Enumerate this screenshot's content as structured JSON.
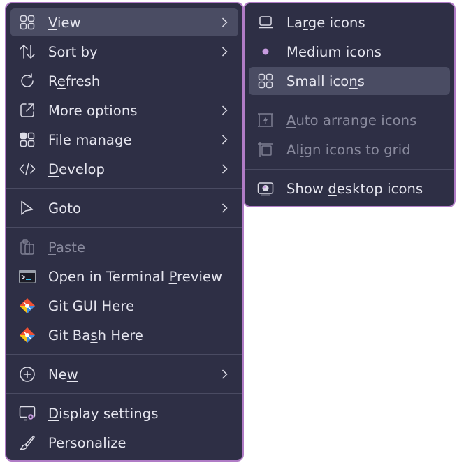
{
  "main_menu": {
    "items": [
      {
        "pre": "",
        "u": "V",
        "post": "iew"
      },
      {
        "pre": "S",
        "u": "o",
        "post": "rt by"
      },
      {
        "pre": "R",
        "u": "e",
        "post": "fresh"
      },
      {
        "pre": "More options",
        "u": "",
        "post": ""
      },
      {
        "pre": "File manage",
        "u": "",
        "post": ""
      },
      {
        "pre": "",
        "u": "D",
        "post": "evelop"
      },
      {
        "pre": "Goto",
        "u": "",
        "post": ""
      },
      {
        "pre": "",
        "u": "P",
        "post": "aste"
      },
      {
        "pre": "Open in Terminal ",
        "u": "P",
        "post": "review"
      },
      {
        "pre": "Git ",
        "u": "G",
        "post": "UI Here"
      },
      {
        "pre": "Git Ba",
        "u": "s",
        "post": "h Here"
      },
      {
        "pre": "Ne",
        "u": "w",
        "post": ""
      },
      {
        "pre": "",
        "u": "D",
        "post": "isplay settings"
      },
      {
        "pre": "Pe",
        "u": "r",
        "post": "sonalize"
      }
    ]
  },
  "sub_menu": {
    "items": [
      {
        "pre": "La",
        "u": "r",
        "post": "ge icons"
      },
      {
        "pre": "",
        "u": "M",
        "post": "edium icons"
      },
      {
        "pre": "Small ico",
        "u": "n",
        "post": "s"
      },
      {
        "pre": "",
        "u": "A",
        "post": "uto arrange icons"
      },
      {
        "pre": "Al",
        "u": "i",
        "post": "gn icons to grid"
      },
      {
        "pre": "Show ",
        "u": "d",
        "post": "esktop icons"
      }
    ]
  },
  "colors": {
    "menu_bg": "#2e2f45",
    "border": "#b07cc6",
    "highlight": "#4a4c63",
    "text": "#e6e6ef",
    "disabled_text": "#8a8b9e",
    "accent": "#c89ce0"
  },
  "icons": {
    "view": "grid-icon",
    "sort": "sort-arrows-icon",
    "refresh": "refresh-icon",
    "more_options": "open-external-icon",
    "file_manage": "apps-grid-icon",
    "develop": "code-icon",
    "goto": "cursor-icon",
    "paste": "clipboard-icon",
    "terminal": "terminal-icon",
    "git_gui": "git-icon",
    "git_bash": "git-icon",
    "new": "plus-circle-icon",
    "display": "display-settings-icon",
    "personalize": "brush-icon",
    "large_icons": "monitor-icon",
    "medium_icons": "bullet-icon",
    "small_icons": "grid-icon",
    "auto_arrange": "auto-arrange-icon",
    "align_grid": "align-grid-icon",
    "show_desktop": "show-desktop-icon"
  }
}
